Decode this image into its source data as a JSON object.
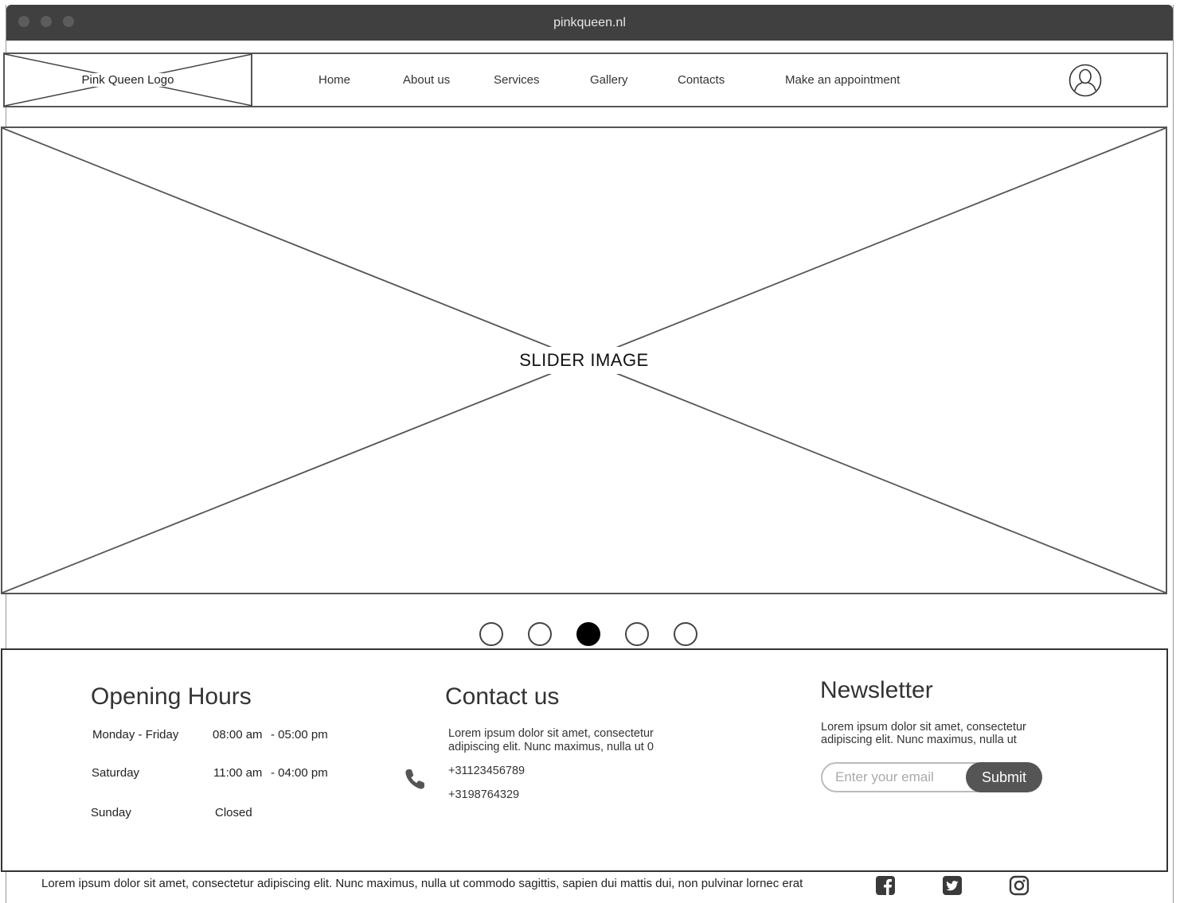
{
  "browser": {
    "title": "pinkqueen.nl"
  },
  "header": {
    "logo_label": "Pink Queen Logo",
    "nav": [
      {
        "label": "Home"
      },
      {
        "label": "About us"
      },
      {
        "label": "Services"
      },
      {
        "label": "Gallery"
      },
      {
        "label": "Contacts"
      },
      {
        "label": "Make an appointment"
      }
    ],
    "user_icon": "user-avatar-icon"
  },
  "slider": {
    "label": "SLIDER IMAGE",
    "dots_total": 5,
    "active_index": 2
  },
  "opening_hours": {
    "title": "Opening Hours",
    "rows": [
      {
        "day": "Monday - Friday",
        "open": "08:00 am",
        "close": "- 05:00 pm"
      },
      {
        "day": "Saturday",
        "open": "11:00 am",
        "close": "- 04:00 pm"
      },
      {
        "day": "Sunday",
        "open": "Closed",
        "close": ""
      }
    ]
  },
  "contact": {
    "title": "Contact us",
    "text_line1": "Lorem ipsum dolor sit amet, consectetur",
    "text_line2": "adipiscing elit. Nunc maximus, nulla ut 0",
    "phone_icon": "phone-icon",
    "phone1": "+31123456789",
    "phone2": "+3198764329"
  },
  "newsletter": {
    "title": "Newsletter",
    "text_line1": "Lorem ipsum dolor sit amet, consectetur",
    "text_line2": "adipiscing elit. Nunc maximus, nulla ut",
    "email_placeholder": "Enter your email",
    "email_value": "",
    "submit_label": "Submit"
  },
  "footer": {
    "text": "Lorem ipsum dolor sit amet, consectetur adipiscing elit. Nunc maximus, nulla ut commodo sagittis, sapien dui mattis dui, non pulvinar lornec erat",
    "social": [
      "facebook-icon",
      "twitter-icon",
      "instagram-icon"
    ]
  },
  "colors": {
    "titlebar": "#404040",
    "button": "#555555",
    "active_dot": "#000000"
  }
}
